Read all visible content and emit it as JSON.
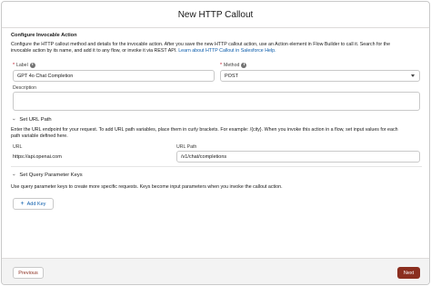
{
  "modal": {
    "title": "New HTTP Callout"
  },
  "configure": {
    "title": "Configure Invocable Action",
    "description_line1": "Configure the HTTP callout method and details for the invocable action. After you save the new HTTP callout action, use an Action element in Flow Builder to call it. Search for the",
    "description_line2_prefix": "invocable action by its name, and add it to any flow, or invoke it via REST API. ",
    "help_link": "Learn about HTTP Callout in Salesforce Help."
  },
  "label_field": {
    "required_mark": "*",
    "label": "Label",
    "value": "GPT 4o Chat Completion"
  },
  "method_field": {
    "required_mark": "*",
    "label": "Method",
    "value": "POST"
  },
  "description_field": {
    "label": "Description",
    "value": ""
  },
  "url_path_section": {
    "title": "Set URL Path",
    "description_line1": "Enter the URL endpoint for your request. To add URL path variables, place them in curly brackets. For example: /{city}. When you invoke this action in a flow, set input values for each",
    "description_line2": "path variable defined here.",
    "url_label": "URL",
    "url_value": "https://api.openai.com",
    "path_label": "URL Path",
    "path_value": "/v1/chat/completions"
  },
  "query_section": {
    "title": "Set Query Parameter Keys",
    "description": "Use query parameter keys to create more specific requests. Keys become input parameters when you invoke the callout action.",
    "add_key_label": "Add Key"
  },
  "footer": {
    "previous_label": "Previous",
    "next_label": "Next"
  },
  "colors": {
    "brand_button": "#8b2e1f",
    "link": "#0b5cab"
  },
  "icons": {
    "info": "info-icon",
    "chevron": "chevron-down-icon",
    "dropdown": "dropdown-arrow-icon",
    "add": "plus-icon"
  }
}
